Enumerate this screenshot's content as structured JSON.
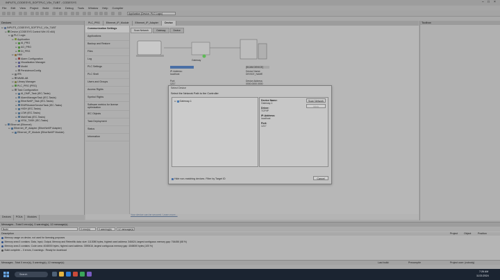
{
  "window": {
    "title": "INPUTS_CODESYS_SOFTPLC_V3x_TUBT - CODESYS",
    "controls": [
      "–",
      "□",
      "×"
    ]
  },
  "menu": [
    "File",
    "Edit",
    "View",
    "Project",
    "Build",
    "Online",
    "Debug",
    "Tools",
    "Window",
    "Help",
    "Compiler"
  ],
  "toolbar": {
    "application_selector": "Application [Device: PLC Logic]"
  },
  "devices_panel": {
    "title": "Devices",
    "tree": [
      {
        "indent": 0,
        "label": "INPUTS_CODESYS_SOFTPLC_V3x_TUBT",
        "color": "#5b6d8b"
      },
      {
        "indent": 1,
        "label": "Device (CODESYS Control Win V3 x64)",
        "color": "#4d6e4a"
      },
      {
        "indent": 2,
        "label": "PLC Logic",
        "color": "#6f6f6f"
      },
      {
        "indent": 3,
        "label": "Application",
        "color": "#7a8e3f"
      },
      {
        "indent": 4,
        "label": "AI_PRG",
        "color": "#4f8a3f"
      },
      {
        "indent": 4,
        "label": "AO_PRG",
        "color": "#4f8a3f"
      },
      {
        "indent": 4,
        "label": "DI_PRG",
        "color": "#4f8a3f"
      },
      {
        "indent": 3,
        "label": "HMI",
        "color": "#8a6f3f"
      },
      {
        "indent": 4,
        "label": "Alarm Configuration",
        "color": "#8a3f3f"
      },
      {
        "indent": 4,
        "label": "Visualization Manager",
        "color": "#5a5a8a"
      },
      {
        "indent": 4,
        "label": "Modbl",
        "color": "#5a5a8a"
      },
      {
        "indent": 4,
        "label": "PersistenceConfig",
        "color": "#6e6e6e"
      },
      {
        "indent": 3,
        "label": "IFB",
        "color": "#6e6e6e"
      },
      {
        "indent": 3,
        "label": "MMIB-AB",
        "color": "#6e6e6e"
      },
      {
        "indent": 3,
        "label": "Library Manager",
        "color": "#7a7a4a"
      },
      {
        "indent": 3,
        "label": "PLC_PRG (PRG)",
        "color": "#4f8a3f"
      },
      {
        "indent": 3,
        "label": "Task Configuration",
        "color": "#6e6e6e"
      },
      {
        "indent": 4,
        "label": "AI_DMP_Task (IEC-Tasks)",
        "color": "#4f6e8a"
      },
      {
        "indent": 4,
        "label": "AlarmManagerTask (IEC-Tasks)",
        "color": "#4f6e8a"
      },
      {
        "indent": 4,
        "label": "EtherNetIP_Task (IEC-Tasks)",
        "color": "#4f6e8a"
      },
      {
        "indent": 4,
        "label": "ENIPModuleServiceTask (IEC-Tasks)",
        "color": "#4f6e8a"
      },
      {
        "indent": 4,
        "label": "HIGH (IEC-Tasks)",
        "color": "#4f6e8a"
      },
      {
        "indent": 4,
        "label": "LOW (IEC-Tasks)",
        "color": "#4f6e8a"
      },
      {
        "indent": 4,
        "label": "MainTask (IEC-Tasks)",
        "color": "#4f6e8a"
      },
      {
        "indent": 4,
        "label": "VISU_TASK (IEC-Tasks)",
        "color": "#4f6e8a"
      },
      {
        "indent": 1,
        "label": "Ethernet (Ethernet)",
        "color": "#4a6a8a"
      },
      {
        "indent": 2,
        "label": "Ethernet_IP_Adapter (EtherNet/IP Adapter)",
        "color": "#4a6a8a"
      },
      {
        "indent": 3,
        "label": "Ethernet_IP_Module (EtherNet/IP Module)",
        "color": "#4a6a8a"
      }
    ],
    "bottom_tabs": [
      "Devices",
      "POUs",
      "Modules"
    ]
  },
  "document_tabs": [
    {
      "label": "PLC_PRG",
      "active": false
    },
    {
      "label": "Ethernet_IP_Module",
      "active": false
    },
    {
      "label": "Ethernet_IP_Adapter",
      "active": false
    },
    {
      "label": "Device",
      "active": true
    }
  ],
  "device_editor": {
    "nav": [
      "Communication Settings",
      "Applications",
      "Backup and Restore",
      "Files",
      "Log",
      "PLC Settings",
      "PLC Shell",
      "Users and Groups",
      "Access Rights",
      "Symbol Rights",
      "Software metrics for license optimization",
      "IEC Objects",
      "Task Deployment",
      "Status",
      "Information"
    ],
    "subtabs": [
      "Scan Network",
      "Gateway",
      "Device"
    ],
    "gateway_label": "Gateway",
    "left_info": [
      "IP-Address:",
      "localhost",
      "Port:",
      "1217"
    ],
    "right_info": [
      "[SCAN DEVICE]",
      "Device Name:",
      "DEVICE_NAME",
      "Device Address:",
      "0000.0000.0000"
    ],
    "link_text": "Your device can be secured. Learn more..."
  },
  "dialog": {
    "title": "Select Device",
    "prompt": "Select the Network Path to the Controller",
    "tree_node": "Gateway-1",
    "info": [
      {
        "label": "Device Name:",
        "value": "Gateway-1"
      },
      {
        "label": "Driver:",
        "value": "TCP/IP"
      },
      {
        "label": "IP-Address:",
        "value": "localhost"
      },
      {
        "label": "Port:",
        "value": "1217"
      }
    ],
    "scan_button": "Scan Network",
    "wink_button": "Wink",
    "checkbox_label": "Hide non-matching devices. Filter by Target ID",
    "cancel_button": "Cancel"
  },
  "toolbox": {
    "title": "Toolbox"
  },
  "messages": {
    "header": "Messages - Total 0 error(s), 0 warning(s), 12 message(s)",
    "filter_source": "Build",
    "filter_counts": [
      "0 error(s)",
      "0 warning(s)",
      "12 message(s)"
    ],
    "columns": [
      "Description",
      "Project",
      "Object",
      "Position"
    ],
    "rows": [
      "Memory usage on device, not used for licensing purposes",
      "Memory area 0 contains: Data, Input, Output, Memory and Retentific data: size: 1113080 bytes, highest used address: 346624, largest contiguous memory gap: 764456 (68 %)",
      "Memory area 3 contains: Code area: 4048000 bytes, highest used address: 3390616, largest contiguous memory gap: 4048000 bytes (100 %)",
      "Build complete -- 0 errors, 0 warnings : Ready for download"
    ]
  },
  "statusbar": {
    "messages_text": "Messages - Total 0 error(s), 0 warning(s), 12 message(s)",
    "last_build": "Last build:",
    "precompile": "Precompile",
    "user": "Project user: (nobody)"
  },
  "taskbar": {
    "search_placeholder": "Search",
    "tray_time": "7:26 AM",
    "tray_date": "11/21/2024"
  }
}
